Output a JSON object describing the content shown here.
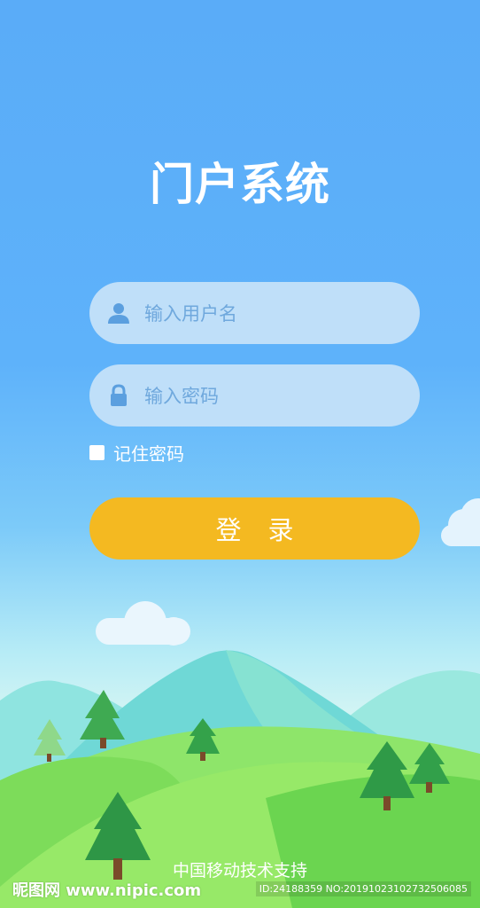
{
  "app": {
    "title": "门户系统"
  },
  "login": {
    "username_placeholder": "输入用户名",
    "password_placeholder": "输入密码",
    "remember_label": "记住密码",
    "submit_label": "登录"
  },
  "footer": {
    "support_text": "中国移动技术支持"
  },
  "watermark": {
    "site_text": "昵图网 www.nipic.com",
    "id_text": "ID:24188359 NO:20191023102732506085"
  },
  "icons": {
    "username": "user-icon",
    "password": "lock-icon"
  },
  "colors": {
    "sky_top": "#5aacf8",
    "field_bg": "#bfdff9",
    "button": "#f4b921",
    "text": "#ffffff"
  }
}
